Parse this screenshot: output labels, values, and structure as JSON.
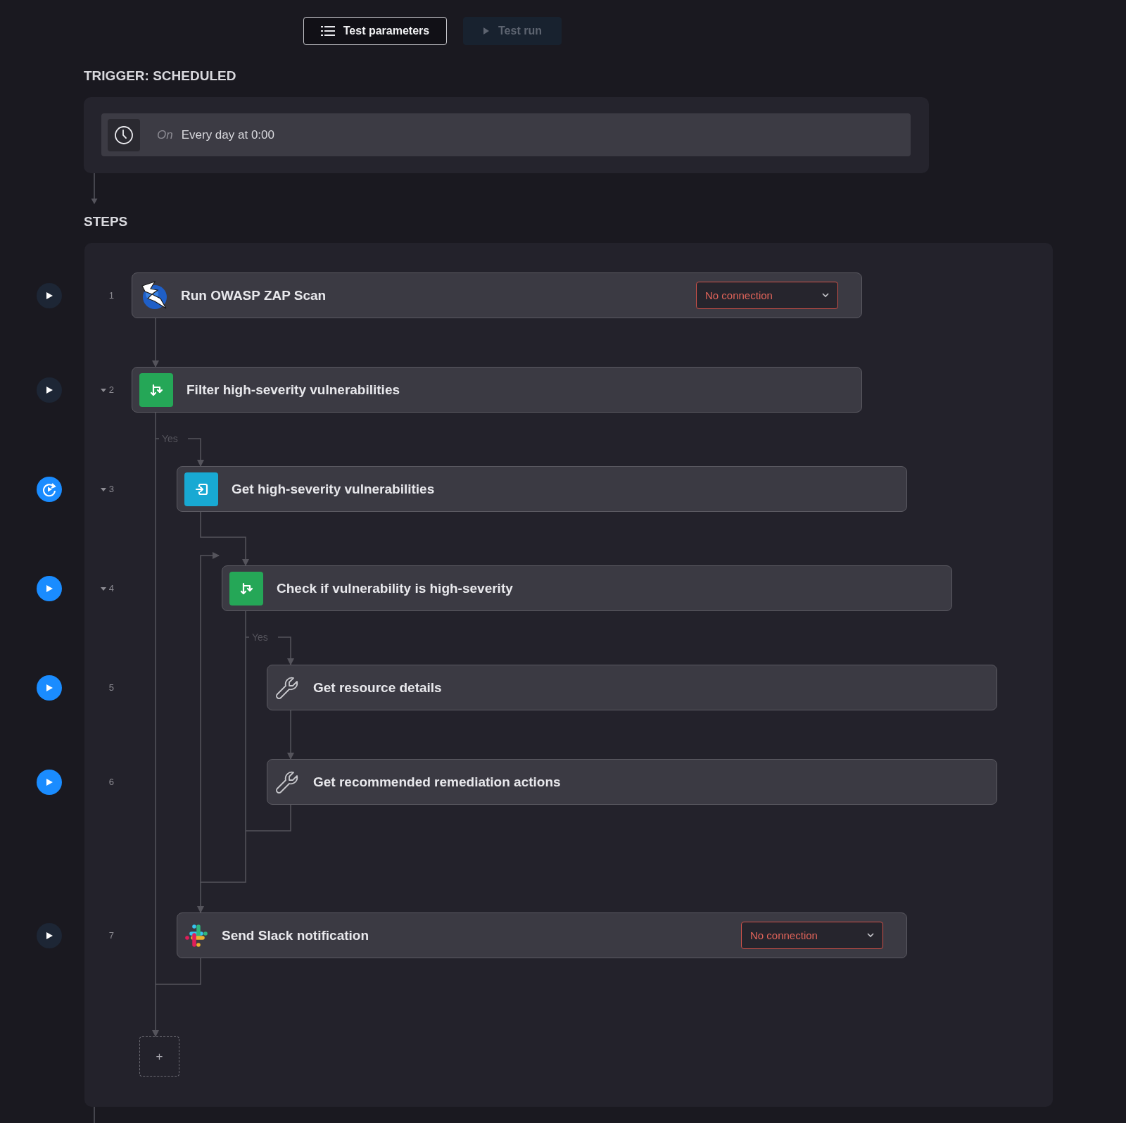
{
  "toolbar": {
    "buttons": [
      {
        "label": "Test parameters",
        "kind": "params",
        "disabled": false
      },
      {
        "label": "Test run",
        "kind": "run",
        "disabled": true
      }
    ]
  },
  "trigger": {
    "heading": "TRIGGER: SCHEDULED",
    "prefix": "On",
    "schedule": "Every day at 0:00"
  },
  "steps_heading": "STEPS",
  "steps": [
    {
      "number": "1",
      "title": "Run OWASP ZAP Scan",
      "kind": "zap",
      "run_enabled": false,
      "connection": {
        "value": "No connection",
        "error": true
      }
    },
    {
      "number": "2",
      "title": "Filter high-severity vulnerabilities",
      "kind": "filter",
      "run_enabled": false,
      "expanded": true,
      "branch_label": "Yes",
      "children": [
        {
          "number": "3",
          "title": "Get high-severity vulnerabilities",
          "kind": "loop",
          "run_enabled": true,
          "expanded": true,
          "children": [
            {
              "number": "4",
              "title": "Check if vulnerability is high-severity",
              "kind": "filter",
              "run_enabled": true,
              "expanded": true,
              "branch_label": "Yes",
              "children": [
                {
                  "number": "5",
                  "title": "Get resource details",
                  "kind": "tool",
                  "run_enabled": true
                },
                {
                  "number": "6",
                  "title": "Get recommended remediation actions",
                  "kind": "tool",
                  "run_enabled": true
                }
              ]
            }
          ]
        },
        {
          "number": "7",
          "title": "Send Slack notification",
          "kind": "slack",
          "run_enabled": false,
          "connection": {
            "value": "No connection",
            "error": true
          }
        }
      ]
    }
  ],
  "add_button": "+"
}
